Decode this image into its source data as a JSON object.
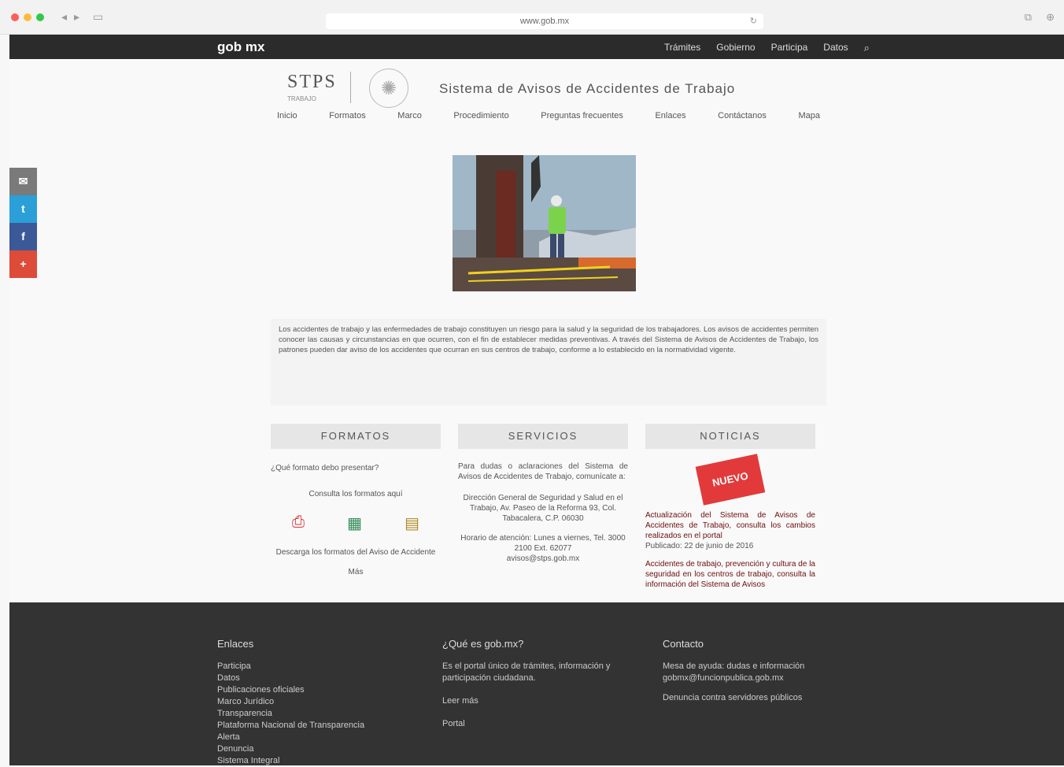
{
  "browser": {
    "url": "www.gob.mx",
    "back_icon": "◂",
    "forward_icon": "▸",
    "reload_icon": "↻",
    "window_icons": [
      "⧉",
      "⊕"
    ]
  },
  "topbar": {
    "logo": "gob mx",
    "links": [
      "Trámites",
      "Gobierno",
      "Participa",
      "Datos"
    ],
    "search_icon": "⌕"
  },
  "header": {
    "agency": "STPS",
    "agency_sub": "TRABAJO",
    "site_title": "Sistema de Avisos de Accidentes de Trabajo",
    "nav": [
      "Inicio",
      "Formatos",
      "Marco",
      "Procedimiento",
      "Preguntas frecuentes",
      "Enlaces",
      "Contáctanos",
      "Mapa"
    ]
  },
  "social": [
    {
      "icon": "mail-icon",
      "glyph": "✉",
      "color": "#7a7a7a"
    },
    {
      "icon": "twitter-icon",
      "glyph": "t",
      "color": "#2a9fd8"
    },
    {
      "icon": "facebook-icon",
      "glyph": "f",
      "color": "#3b5998"
    },
    {
      "icon": "google-plus-icon",
      "glyph": "+",
      "color": "#dd4b39"
    }
  ],
  "description": "Los accidentes de trabajo y las enfermedades de trabajo constituyen un riesgo para la salud y la seguridad de los trabajadores. Los avisos de accidentes permiten conocer las causas y circunstancias en que ocurren, con el fin de establecer medidas preventivas. A través del Sistema de Avisos de Accidentes de Trabajo, los patrones pueden dar aviso de los accidentes que ocurran en sus centros de trabajo, conforme a lo establecido en la normatividad vigente.",
  "columns": {
    "formatos": {
      "title": "FORMATOS",
      "q1": "¿Qué formato debo presentar?",
      "q2": "Consulta los formatos aquí",
      "download": "Descarga los formatos del Aviso de Accidente",
      "more": "Más"
    },
    "servicios": {
      "title": "SERVICIOS",
      "p1": "Para dudas o aclaraciones del Sistema de Avisos de Accidentes de Trabajo, comunícate a:",
      "p2": "Dirección General de Seguridad y Salud en el Trabajo, Av. Paseo de la Reforma 93, Col. Tabacalera, C.P. 06030",
      "p3": "Horario de atención: Lunes a viernes, Tel. 3000 2100 Ext. 62077",
      "email": "avisos@stps.gob.mx"
    },
    "noticias": {
      "title": "NOTICIAS",
      "badge": "NUEVO",
      "n1": "Actualización del Sistema de Avisos de Accidentes de Trabajo, consulta los cambios realizados en el portal",
      "n1_date": "Publicado: 22 de junio de 2016",
      "n2": "Accidentes de trabajo, prevención y cultura de la seguridad en los centros de trabajo, consulta la información del Sistema de Avisos"
    }
  },
  "footer": {
    "enlaces_title": "Enlaces",
    "enlaces": [
      "Participa",
      "Datos",
      "Publicaciones oficiales",
      "Marco Jurídico",
      "Transparencia",
      "Plataforma Nacional de Transparencia",
      "Alerta",
      "Denuncia",
      "Sistema Integral"
    ],
    "que_title": "¿Qué es gob.mx?",
    "que_text": "Es el portal único de trámites, información y participación ciudadana.",
    "que_links": [
      "Leer más",
      "Portal"
    ],
    "contacto_title": "Contacto",
    "contacto_text": "Mesa de ayuda: dudas e información",
    "contacto_email": "gobmx@funcionpublica.gob.mx",
    "contacto_link": "Denuncia contra servidores públicos"
  }
}
